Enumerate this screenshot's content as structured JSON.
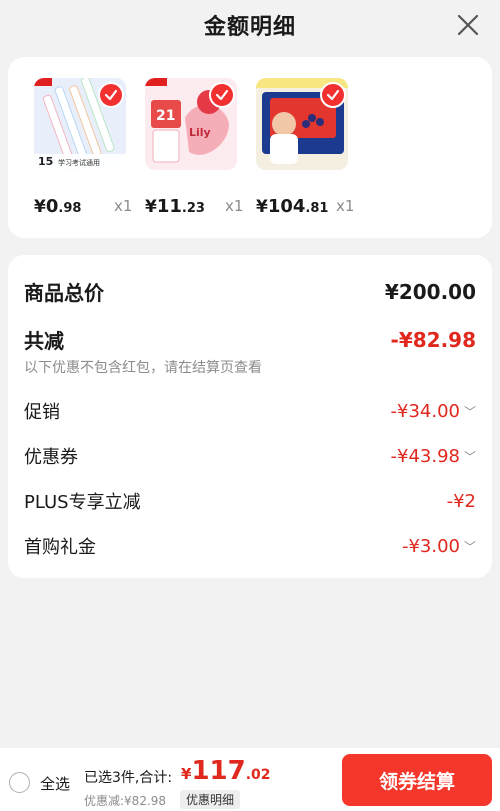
{
  "header": {
    "title": "金额明细",
    "close_icon": "close-icon"
  },
  "products": [
    {
      "thumb_text": "15",
      "thumb_sub": "学习考试通用",
      "currency": "¥",
      "price_int": "0",
      "price_dec": ".98",
      "qty": "x1"
    },
    {
      "thumb_text": "21",
      "thumb_sub": "Lily",
      "currency": "¥",
      "price_int": "11",
      "price_dec": ".23",
      "qty": "x1"
    },
    {
      "thumb_text": "",
      "thumb_sub": "",
      "currency": "¥",
      "price_int": "104",
      "price_dec": ".81",
      "qty": "x1"
    }
  ],
  "summary": {
    "total_label": "商品总价",
    "total_value": "¥200.00",
    "reduce_label": "共减",
    "reduce_value": "-¥82.98",
    "note": "以下优惠不包含红包，请在结算页查看",
    "items": [
      {
        "label": "促销",
        "value": "-¥34.00",
        "chevron": "﹀"
      },
      {
        "label": "优惠券",
        "value": "-¥43.98",
        "chevron": "﹀"
      },
      {
        "label": "PLUS专享立减",
        "value": "-¥2",
        "chevron": ""
      },
      {
        "label": "首购礼金",
        "value": "-¥3.00",
        "chevron": "﹀"
      }
    ]
  },
  "bottom": {
    "select_all": "全选",
    "selected_text": "已选3件,合计:",
    "grand_currency": "¥",
    "grand_int": "117",
    "grand_dec": ".02",
    "savings": "优惠减:¥82.98",
    "detail_button": "优惠明细",
    "checkout_button": "领券结算"
  },
  "colors": {
    "accent": "#f23030",
    "price_red": "#e0281e",
    "bg": "#f2f2f2"
  }
}
